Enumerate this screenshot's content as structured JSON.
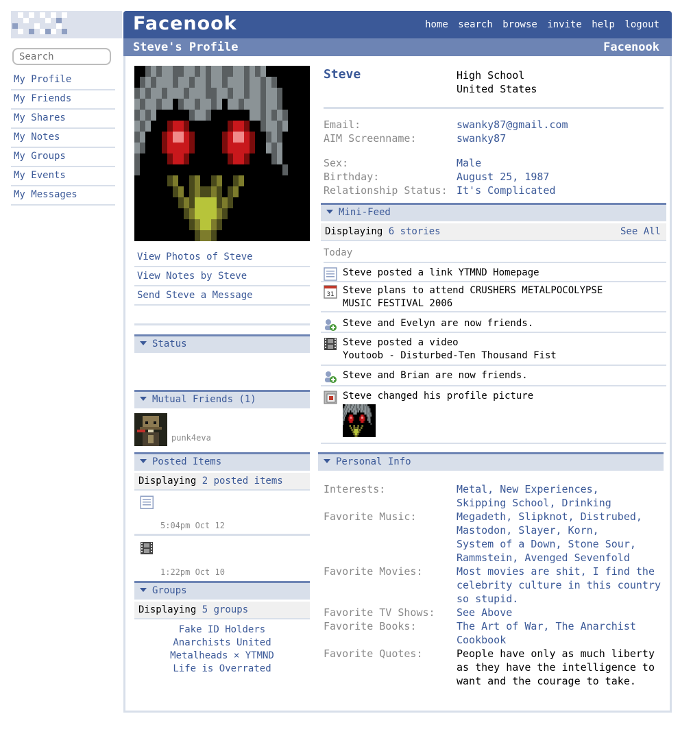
{
  "sidebar": {
    "search_placeholder": "Search",
    "items": [
      {
        "label": "My Profile"
      },
      {
        "label": "My Friends"
      },
      {
        "label": "My Shares"
      },
      {
        "label": "My Notes"
      },
      {
        "label": "My Groups"
      },
      {
        "label": "My Events"
      },
      {
        "label": "My Messages"
      }
    ]
  },
  "header": {
    "brand": "Facenook",
    "nav": [
      "home",
      "search",
      "browse",
      "invite",
      "help",
      "logout"
    ],
    "profile_title": "Steve's Profile",
    "brand_small": "Facenook"
  },
  "profile": {
    "name": "Steve",
    "school": "High School",
    "country": "United States",
    "links": [
      "View Photos of Steve",
      "View Notes by Steve",
      "Send Steve a Message"
    ]
  },
  "contact": {
    "email_label": "Email:",
    "email": "swanky87@gmail.com",
    "aim_label": "AIM Screenname:",
    "aim": "swanky87",
    "sex_label": "Sex:",
    "sex": "Male",
    "birthday_label": "Birthday:",
    "birthday": "August 25, 1987",
    "relationship_label": "Relationship Status:",
    "relationship": "It's Complicated"
  },
  "status": {
    "title": "Status"
  },
  "mutual_friends": {
    "title": "Mutual Friends (1)",
    "friend_name": "punk4eva"
  },
  "posted_items": {
    "title": "Posted Items",
    "displaying_prefix": "Displaying ",
    "displaying_link": "2 posted items",
    "items": [
      {
        "time": "5:04pm Oct 12",
        "icon": "note-icon"
      },
      {
        "time": "1:22pm Oct 10",
        "icon": "film-icon"
      }
    ]
  },
  "groups": {
    "title": "Groups",
    "displaying_prefix": "Displaying ",
    "displaying_link": "5 groups",
    "items": [
      "Fake ID Holders",
      "Anarchists United",
      "Metalheads × YTMND",
      "Life is Overrated"
    ]
  },
  "minifeed": {
    "title": "Mini-Feed",
    "displaying_prefix": "Displaying ",
    "displaying_link": "6 stories",
    "see_all": "See All",
    "day": "Today",
    "stories": [
      {
        "icon": "link-icon",
        "line1": "Steve posted a link YTMND Homepage"
      },
      {
        "icon": "calendar-icon",
        "icon_text": "31",
        "line1": "Steve plans to attend CRUSHERS METALPOCOLYPSE",
        "line2": "MUSIC FESTIVAL 2006"
      },
      {
        "icon": "friends-icon",
        "line1": "Steve and Evelyn are now friends."
      },
      {
        "icon": "film-icon",
        "line1": "Steve posted a video",
        "line2": "Youtoob - Disturbed-Ten Thousand Fist"
      },
      {
        "icon": "friends-icon",
        "line1": "Steve and Brian are now friends."
      },
      {
        "icon": "picture-icon",
        "line1": "Steve changed his profile picture"
      }
    ]
  },
  "personal_info": {
    "title": "Personal Info",
    "interests_label": "Interests:",
    "interests_1": "Metal, New Experiences,",
    "interests_2": "Skipping School, Drinking",
    "music_label": "Favorite Music:",
    "music_1": "Megadeth, Slipknot, Distrubed,",
    "music_2": "Mastodon, Slayer, Korn,",
    "music_3": "System of a Down, Stone Sour,",
    "music_4": "Rammstein, Avenged Sevenfold",
    "movies_label": "Favorite Movies:",
    "movies_1": "Most movies are shit, I find the",
    "movies_2": "celebrity culture in this country",
    "movies_3": "so stupid.",
    "tv_label": "Favorite TV Shows:",
    "tv": "See Above",
    "books_label": "Favorite Books:",
    "books_1": "The Art of War, The Anarchist",
    "books_2": "Cookbook",
    "quotes_label": "Favorite Quotes:",
    "quotes_1": "People have only as much liberty",
    "quotes_2": "as they have the intelligence to",
    "quotes_3": "want and the courage to take."
  },
  "colors": {
    "brand_blue": "#3b5998",
    "light_blue": "#d8dfea",
    "mid_blue": "#6d84b4"
  }
}
